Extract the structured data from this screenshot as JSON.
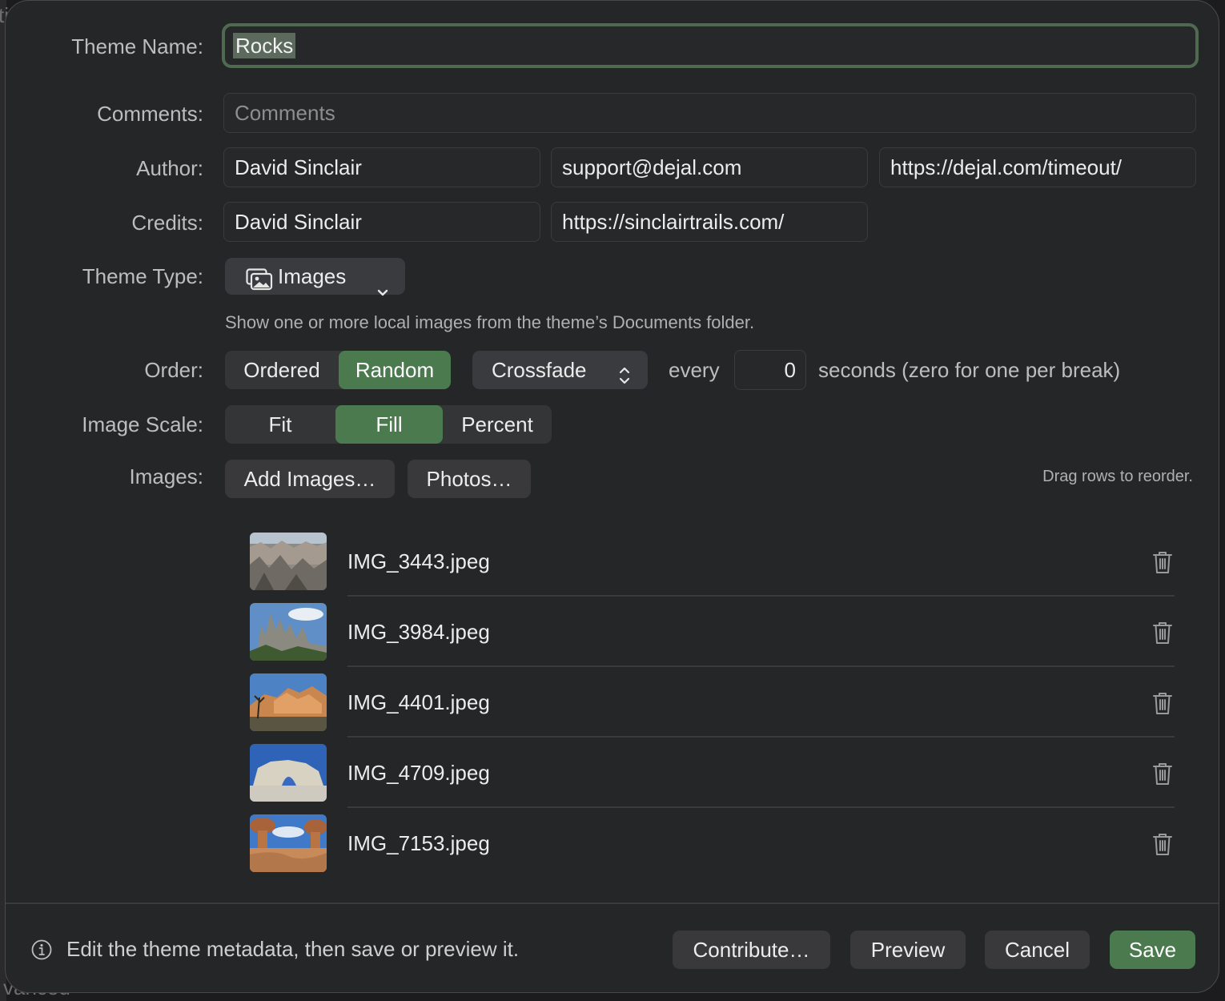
{
  "backdrop": {
    "corner_text": "ti",
    "bottom_text": "vanced"
  },
  "form": {
    "theme_name": {
      "label": "Theme Name:",
      "value": "Rocks"
    },
    "comments": {
      "label": "Comments:",
      "placeholder": "Comments"
    },
    "author": {
      "label": "Author:",
      "name": "David Sinclair",
      "email": "support@dejal.com",
      "url": "https://dejal.com/timeout/"
    },
    "credits": {
      "label": "Credits:",
      "name": "David Sinclair",
      "url": "https://sinclairtrails.com/"
    },
    "theme_type": {
      "label": "Theme Type:",
      "selected": "Images",
      "icon": "photo-stack-icon",
      "description": "Show one or more local images from the theme’s Documents folder."
    },
    "order": {
      "label": "Order:",
      "options": [
        "Ordered",
        "Random"
      ],
      "selected": "Random",
      "transition": "Crossfade",
      "every_label": "every",
      "seconds": "0",
      "seconds_suffix": "seconds (zero for one per break)"
    },
    "image_scale": {
      "label": "Image Scale:",
      "options": [
        "Fit",
        "Fill",
        "Percent"
      ],
      "selected": "Fill"
    },
    "images": {
      "label": "Images:",
      "add_button": "Add Images…",
      "photos_button": "Photos…",
      "hint": "Drag rows to reorder.",
      "items": [
        {
          "filename": "IMG_3443.jpeg"
        },
        {
          "filename": "IMG_3984.jpeg"
        },
        {
          "filename": "IMG_4401.jpeg"
        },
        {
          "filename": "IMG_4709.jpeg"
        },
        {
          "filename": "IMG_7153.jpeg"
        }
      ]
    }
  },
  "footer": {
    "info_text": "Edit the theme metadata, then save or preview it.",
    "buttons": {
      "contribute": "Contribute…",
      "preview": "Preview",
      "cancel": "Cancel",
      "save": "Save"
    }
  },
  "colors": {
    "accent": "#4b7a4e",
    "background": "#252628",
    "field": "#27282a",
    "focus_ring": "#4f6a50"
  }
}
